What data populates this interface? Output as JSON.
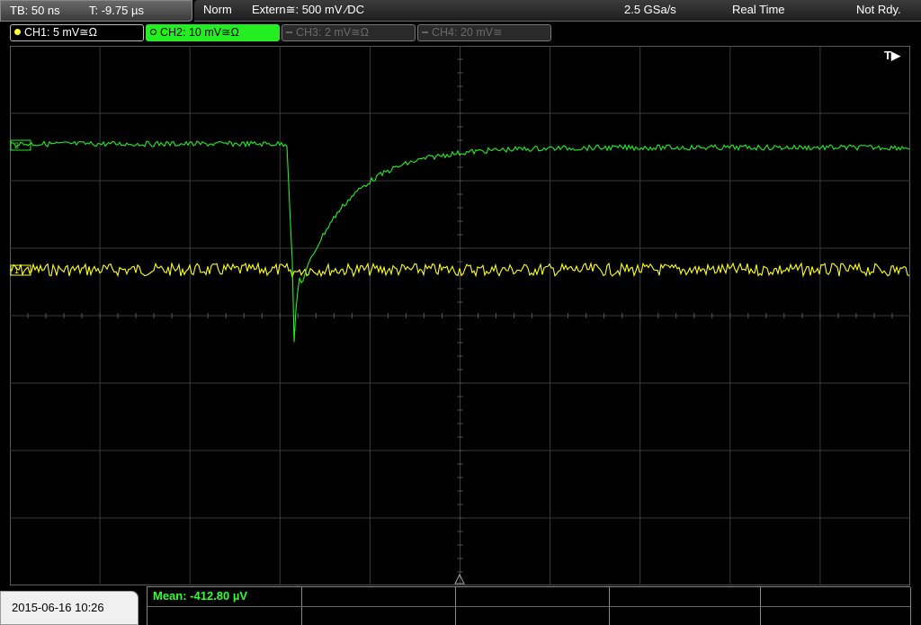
{
  "timebase": {
    "tb": "TB: 50 ns",
    "t": "T: -9.75 µs"
  },
  "status": {
    "mode": "Norm",
    "trigger": "Extern≅: 500 mV ⁄DC",
    "sample_rate": "2.5 GSa/s",
    "acquisition": "Real Time",
    "state": "Not Rdy."
  },
  "channels": [
    {
      "label": "CH1: 5 mV≅Ω",
      "color": "#ffff33",
      "active": true
    },
    {
      "label": "CH2: 10 mV≅Ω",
      "color": "#22ee22",
      "active": true
    },
    {
      "label": "CH3: 2 mV≅Ω",
      "color": "#666666",
      "active": false
    },
    {
      "label": "CH4: 20 mV≅",
      "color": "#666666",
      "active": false
    }
  ],
  "screen": {
    "trigger_marker": "T▶",
    "ch2_marker": "2",
    "ch1_marker": "1",
    "grid_divisions": {
      "x": 10,
      "y": 8
    }
  },
  "measurement": {
    "mean": "Mean: -412.80 µV"
  },
  "datetime": "2015-06-16 10:26"
}
